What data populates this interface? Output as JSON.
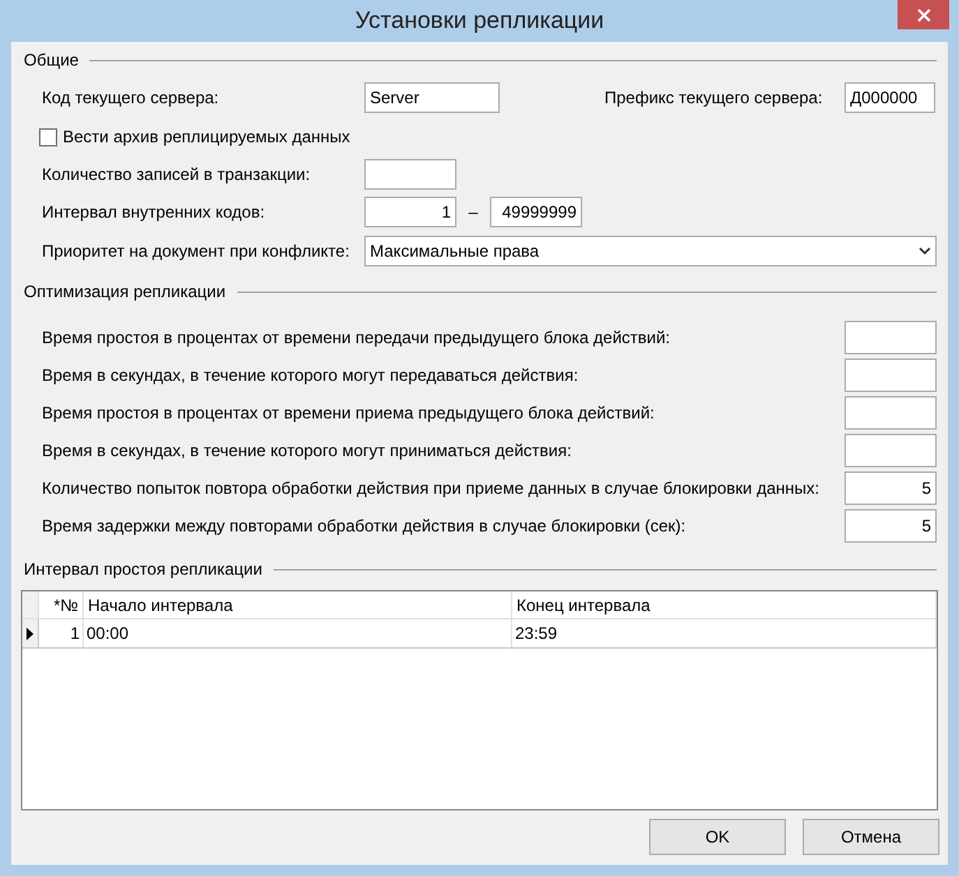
{
  "window": {
    "title": "Установки репликации"
  },
  "general": {
    "title": "Общие",
    "server_code": {
      "label": "Код текущего сервера:",
      "value": "Server"
    },
    "server_prefix": {
      "label": "Префикс текущего сервера:",
      "value": "Д000000"
    },
    "archive": {
      "label": "Вести архив реплицируемых данных",
      "checked": false
    },
    "transaction_records": {
      "label": "Количество записей в транзакции:"
    },
    "code_interval": {
      "label": "Интервал внутренних кодов:",
      "from": "1",
      "separator": "–",
      "to": "49999999"
    },
    "priority": {
      "label": "Приоритет на документ при конфликте:",
      "value": "Максимальные права"
    }
  },
  "optimization": {
    "title": "Оптимизация репликации",
    "fields": [
      {
        "label": "Время простоя в процентах от времени передачи предыдущего блока действий:"
      },
      {
        "label": "Время в секундах, в течение которого могут передаваться действия:"
      },
      {
        "label": "Время простоя в процентах от времени приема предыдущего блока действий:"
      },
      {
        "label": "Время в секундах, в течение которого могут приниматься действия:"
      },
      {
        "label": "Количество попыток повтора обработки действия при приеме данных в случае блокировки данных:",
        "value": "5"
      },
      {
        "label": "Время задержки между повторами обработки действия в случае блокировки (сек):",
        "value": "5"
      }
    ]
  },
  "idle_interval": {
    "title": "Интервал простоя репликации",
    "table": {
      "columns": [
        "*№",
        "Начало интервала",
        "Конец интервала"
      ],
      "rows": [
        {
          "cells": [
            "1",
            "00:00",
            "23:59"
          ],
          "selected": true
        }
      ]
    }
  },
  "buttons": [
    "OK",
    "Отмена"
  ]
}
